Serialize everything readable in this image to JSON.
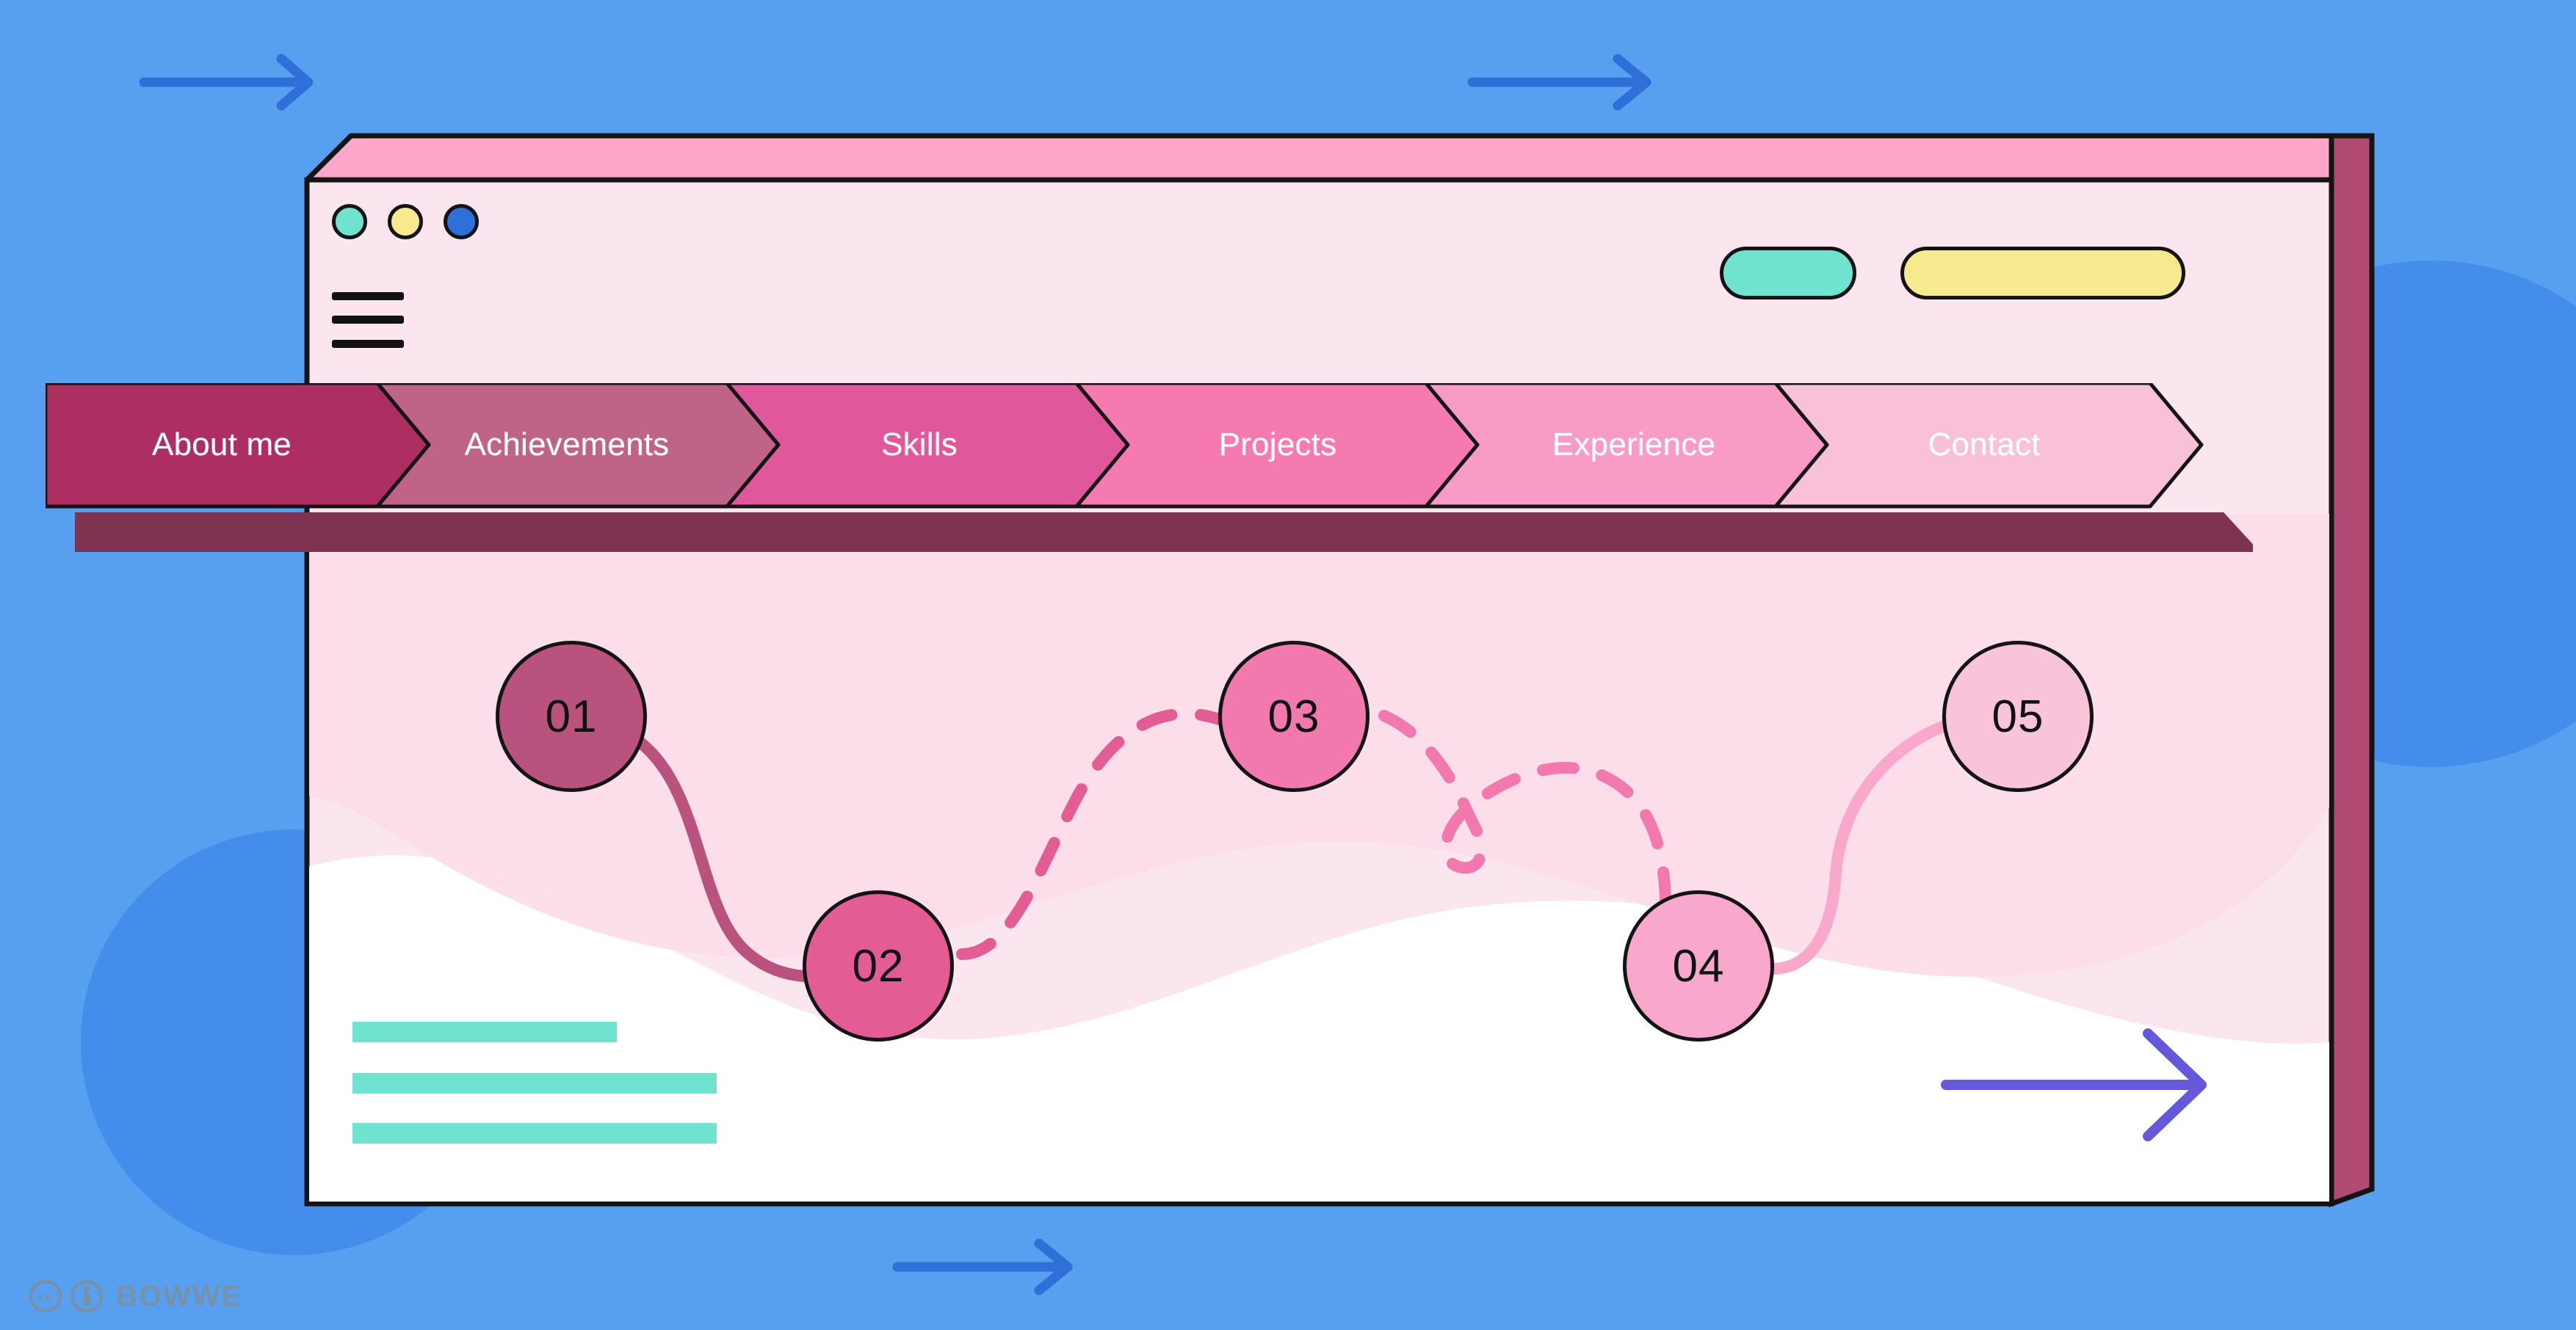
{
  "page": {
    "background_color": "#57a0ef",
    "decor_circle_color": "#3b82e8"
  },
  "background_arrows": [
    {
      "name": "arrow-top-left",
      "color": "#2f6fd8"
    },
    {
      "name": "arrow-top-right",
      "color": "#2f6fd8"
    },
    {
      "name": "arrow-bottom-center",
      "color": "#2f6fd8"
    }
  ],
  "browser_window": {
    "title_bar_color": "#fca6c9",
    "body_color": "#fbe6ef",
    "side_panel_color": "#b14a72",
    "border_color": "#141414",
    "traffic_lights": [
      {
        "name": "traffic-light-green",
        "color": "#6fe3cf"
      },
      {
        "name": "traffic-light-yellow",
        "color": "#f7e98e"
      },
      {
        "name": "traffic-light-blue",
        "color": "#2f6fd8"
      }
    ],
    "menu_button": {
      "name": "hamburger-menu-button",
      "label": "Menu"
    },
    "action_buttons": [
      {
        "name": "pill-button-teal",
        "label": "",
        "color": "#6fe3cf"
      },
      {
        "name": "pill-button-yellow",
        "label": "",
        "color": "#f7e98e"
      }
    ]
  },
  "nav": {
    "shadow_color": "#7d3351",
    "items": [
      {
        "label": "About me",
        "color": "#ad2f61",
        "active": true
      },
      {
        "label": "Achievements",
        "color": "#bf6389",
        "active": false
      },
      {
        "label": "Skills",
        "color": "#e0589b",
        "active": false
      },
      {
        "label": "Projects",
        "color": "#f57ab0",
        "active": false
      },
      {
        "label": "Experience",
        "color": "#f99cc5",
        "active": false
      },
      {
        "label": "Contact",
        "color": "#f9c1d8",
        "active": false
      }
    ]
  },
  "content": {
    "blob_color": "#fbdde9",
    "page_color": "#ffffff",
    "steps": [
      {
        "number": "01",
        "fill": "#b9527d",
        "connector": "solid",
        "connector_color": "#b9527d"
      },
      {
        "number": "02",
        "fill": "#e35c94",
        "connector": "dashed",
        "connector_color": "#e35c94"
      },
      {
        "number": "03",
        "fill": "#f279ae",
        "connector": "dashed",
        "connector_color": "#f279ae"
      },
      {
        "number": "04",
        "fill": "#f9a8cb",
        "connector": "solid",
        "connector_color": "#f9a8cb"
      },
      {
        "number": "05",
        "fill": "#f9c3da",
        "connector": "none",
        "connector_color": "#f9c3da"
      }
    ],
    "text_placeholder_bars": [
      {
        "name": "placeholder-bar-1",
        "color": "#6fe3cf"
      },
      {
        "name": "placeholder-bar-2",
        "color": "#6fe3cf"
      },
      {
        "name": "placeholder-bar-3",
        "color": "#6fe3cf"
      }
    ],
    "cta_arrow": {
      "name": "cta-arrow-icon",
      "color": "#6559db"
    }
  },
  "footer": {
    "license_icons": [
      "cc-icon",
      "by-icon"
    ],
    "brand": "BOWWE"
  }
}
